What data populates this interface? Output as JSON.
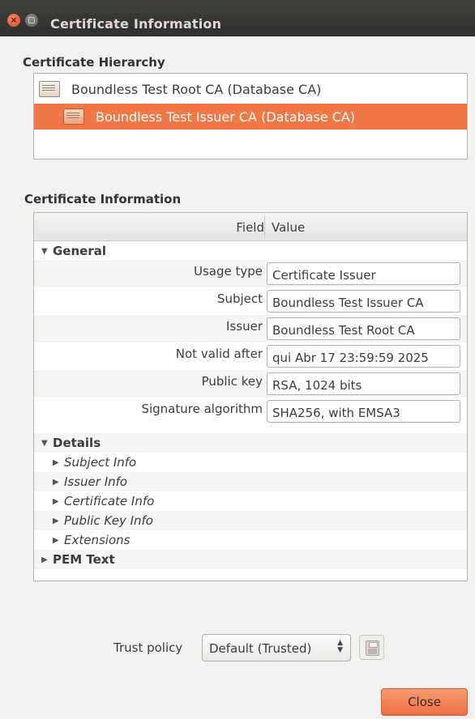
{
  "window": {
    "title": "Certificate Information",
    "close_glyph": "×"
  },
  "hierarchy": {
    "label": "Certificate Hierarchy",
    "items": [
      {
        "label": "Boundless Test Root CA (Database CA)",
        "icon": "certificate-icon",
        "selected": false
      },
      {
        "label": "Boundless Test Issuer CA (Database CA)",
        "icon": "certificate-icon",
        "selected": true
      }
    ]
  },
  "info": {
    "label": "Certificate Information",
    "header": {
      "field": "Field",
      "value": "Value"
    },
    "general": {
      "label": "General",
      "fields": [
        {
          "name": "Usage type",
          "value": "Certificate Issuer"
        },
        {
          "name": "Subject",
          "value": "Boundless Test Issuer CA"
        },
        {
          "name": "Issuer",
          "value": "Boundless Test Root CA"
        },
        {
          "name": "Not valid after",
          "value": "qui Abr 17 23:59:59 2025"
        },
        {
          "name": "Public key",
          "value": "RSA, 1024 bits"
        },
        {
          "name": "Signature algorithm",
          "value": "SHA256, with EMSA3"
        }
      ]
    },
    "details": {
      "label": "Details",
      "items": [
        "Subject Info",
        "Issuer Info",
        "Certificate Info",
        "Public Key Info",
        "Extensions"
      ]
    },
    "pem": {
      "label": "PEM Text"
    }
  },
  "trust": {
    "label": "Trust policy",
    "selected": "Default (Trusted)"
  },
  "buttons": {
    "close": "Close"
  },
  "colors": {
    "accent": "#f07746",
    "titlebar": "#3c3b37"
  }
}
